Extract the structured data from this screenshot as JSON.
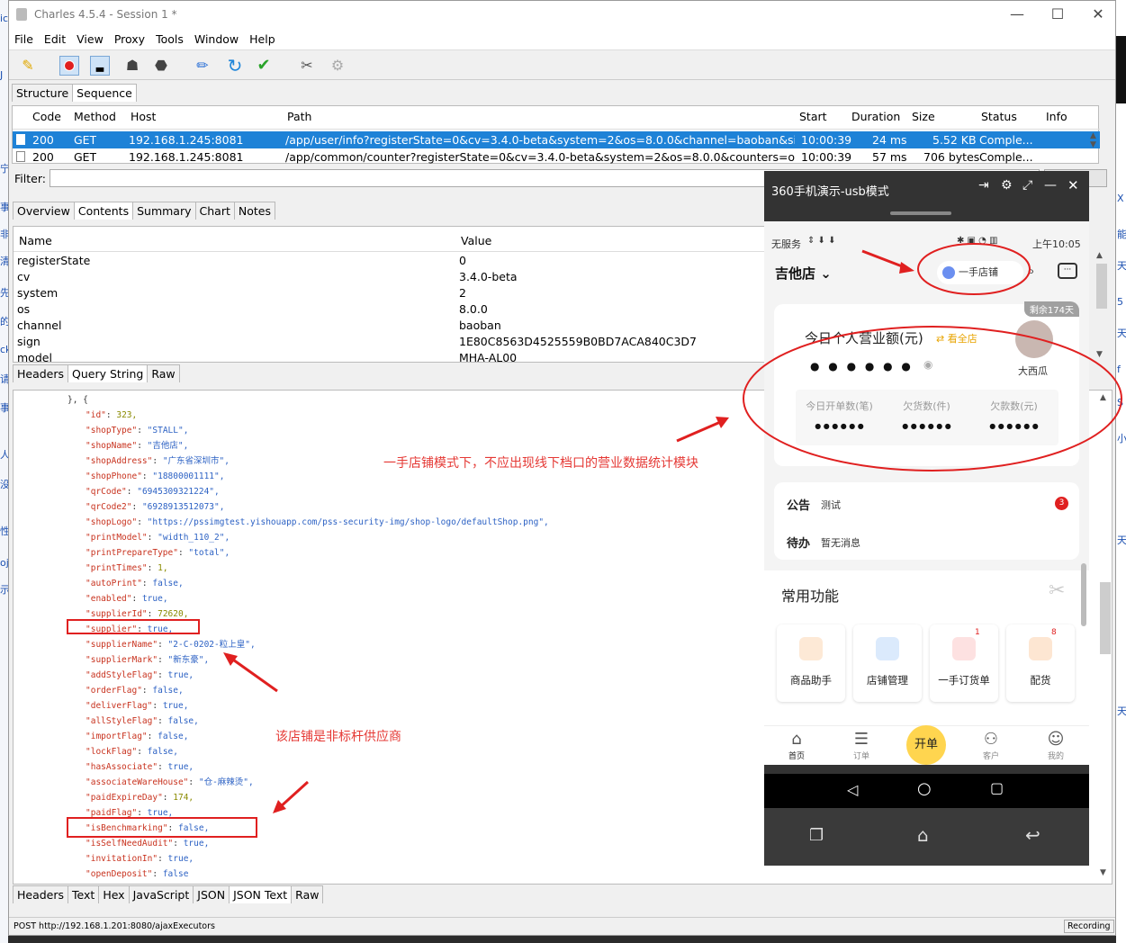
{
  "window": {
    "title": "Charles 4.5.4 - Session 1 *"
  },
  "menu": [
    "File",
    "Edit",
    "View",
    "Proxy",
    "Tools",
    "Window",
    "Help"
  ],
  "toolbar_icons": [
    "broom-icon",
    "record-icon",
    "throttle-icon",
    "turtle-icon",
    "stop-icon",
    "pen-icon",
    "refresh-icon",
    "check-icon",
    "tools-icon",
    "gear-icon"
  ],
  "view_tabs": [
    "Structure",
    "Sequence"
  ],
  "sequence": {
    "columns": [
      "Code",
      "Method",
      "Host",
      "Path",
      "Start",
      "Duration",
      "Size",
      "Status",
      "Info"
    ],
    "rows": [
      {
        "code": "200",
        "method": "GET",
        "host": "192.168.1.245:8081",
        "path": "/app/user/info?registerState=0&cv=3.4.0-beta&system=2&os=8.0.0&channel=baoban&sign=...",
        "start": "10:00:39",
        "duration": "24 ms",
        "size": "5.52 KB",
        "status": "Comple..."
      },
      {
        "code": "200",
        "method": "GET",
        "host": "192.168.1.245:8081",
        "path": "/app/common/counter?registerState=0&cv=3.4.0-beta&system=2&os=8.0.0&counters=order...",
        "start": "10:00:39",
        "duration": "57 ms",
        "size": "706 bytes",
        "status": "Comple..."
      }
    ]
  },
  "filter": {
    "label": "Filter:",
    "value": ""
  },
  "request_tabs": [
    "Overview",
    "Contents",
    "Summary",
    "Chart",
    "Notes"
  ],
  "params": {
    "columns": [
      "Name",
      "Value"
    ],
    "rows": [
      {
        "name": "registerState",
        "value": "0"
      },
      {
        "name": "cv",
        "value": "3.4.0-beta"
      },
      {
        "name": "system",
        "value": "2"
      },
      {
        "name": "os",
        "value": "8.0.0"
      },
      {
        "name": "channel",
        "value": "baoban"
      },
      {
        "name": "sign",
        "value": "1E80C8563D4525559B0BD7ACA840C3D7"
      },
      {
        "name": "model",
        "value": "MHA-AL00"
      }
    ]
  },
  "param_tabs": [
    "Headers",
    "Query String",
    "Raw"
  ],
  "json_lines": [
    {
      "k": "",
      "v": "}, {",
      "t": "p"
    },
    {
      "k": "\"id\"",
      "v": "323,",
      "t": "n"
    },
    {
      "k": "\"shopType\"",
      "v": "\"STALL\",",
      "t": "s"
    },
    {
      "k": "\"shopName\"",
      "v": "\"吉他店\",",
      "t": "s"
    },
    {
      "k": "\"shopAddress\"",
      "v": "\"广东省深圳市\",",
      "t": "s"
    },
    {
      "k": "\"shopPhone\"",
      "v": "\"18800001111\",",
      "t": "s"
    },
    {
      "k": "\"qrCode\"",
      "v": "\"6945309321224\",",
      "t": "s"
    },
    {
      "k": "\"qrCode2\"",
      "v": "\"6928913512073\",",
      "t": "s"
    },
    {
      "k": "\"shopLogo\"",
      "v": "\"https://pssimgtest.yishouapp.com/pss-security-img/shop-logo/defaultShop.png\",",
      "t": "s"
    },
    {
      "k": "\"printModel\"",
      "v": "\"width_110_2\",",
      "t": "s"
    },
    {
      "k": "\"printPrepareType\"",
      "v": "\"total\",",
      "t": "s"
    },
    {
      "k": "\"printTimes\"",
      "v": "1,",
      "t": "n"
    },
    {
      "k": "\"autoPrint\"",
      "v": "false,",
      "t": "b"
    },
    {
      "k": "\"enabled\"",
      "v": "true,",
      "t": "b"
    },
    {
      "k": "\"supplierId\"",
      "v": "72620,",
      "t": "n"
    },
    {
      "k": "\"supplier\"",
      "v": "true,",
      "t": "b"
    },
    {
      "k": "\"supplierName\"",
      "v": "\"2-C-0202-粒上皇\",",
      "t": "s"
    },
    {
      "k": "\"supplierMark\"",
      "v": "\"新东豪\",",
      "t": "s"
    },
    {
      "k": "\"addStyleFlag\"",
      "v": "true,",
      "t": "b"
    },
    {
      "k": "\"orderFlag\"",
      "v": "false,",
      "t": "b"
    },
    {
      "k": "\"deliverFlag\"",
      "v": "true,",
      "t": "b"
    },
    {
      "k": "\"allStyleFlag\"",
      "v": "false,",
      "t": "b"
    },
    {
      "k": "\"importFlag\"",
      "v": "false,",
      "t": "b"
    },
    {
      "k": "\"lockFlag\"",
      "v": "false,",
      "t": "b"
    },
    {
      "k": "\"hasAssociate\"",
      "v": "true,",
      "t": "b"
    },
    {
      "k": "\"associateWareHouse\"",
      "v": "\"仓-麻辣烫\",",
      "t": "s"
    },
    {
      "k": "\"paidExpireDay\"",
      "v": "174,",
      "t": "n"
    },
    {
      "k": "\"paidFlag\"",
      "v": "true,",
      "t": "b"
    },
    {
      "k": "\"isBenchmarking\"",
      "v": "false,",
      "t": "b"
    },
    {
      "k": "\"isSelfNeedAudit\"",
      "v": "true,",
      "t": "b"
    },
    {
      "k": "\"invitationIn\"",
      "v": "true,",
      "t": "b"
    },
    {
      "k": "\"openDeposit\"",
      "v": "false",
      "t": "b"
    }
  ],
  "body_tabs": [
    "Headers",
    "Text",
    "Hex",
    "JavaScript",
    "JSON",
    "JSON Text",
    "Raw"
  ],
  "status": {
    "left": "POST http://192.168.1.201:8080/ajaxExecutors",
    "right": "Recording"
  },
  "annotations": {
    "phone_note": "一手店铺模式下，不应出现线下档口的营业数据统计模块",
    "json_note": "该店铺是非标杆供应商"
  },
  "phone": {
    "title": "360手机演示-usb模式",
    "status_left": "无服务",
    "time": "上午10:05",
    "store": "吉他店",
    "mode_pill": "一手店铺",
    "remain_badge": "剩余174天",
    "revenue_title": "今日个人营业额(元)",
    "view_all": "看全店",
    "revenue_masked": "● ● ● ● ● ●",
    "avatar_name": "大西瓜",
    "stats": [
      {
        "label": "今日开单数(笔)",
        "value": "● ● ● ● ● ●"
      },
      {
        "label": "欠货数(件)",
        "value": "● ● ● ● ● ●"
      },
      {
        "label": "欠款数(元)",
        "value": "● ● ● ● ● ●"
      }
    ],
    "notice_label": "公告",
    "notice_text": "测试",
    "notice_badge": "3",
    "todo_label": "待办",
    "todo_text": "暂无消息",
    "common_title": "常用功能",
    "functions": [
      {
        "label": "商品助手",
        "badge": ""
      },
      {
        "label": "店铺管理",
        "badge": ""
      },
      {
        "label": "一手订货单",
        "badge": "1"
      },
      {
        "label": "配货",
        "badge": "8"
      }
    ],
    "nav": [
      {
        "label": "首页",
        "icon": "home-icon"
      },
      {
        "label": "订单",
        "icon": "list-icon"
      },
      {
        "label": "开单",
        "icon": "open-order-button"
      },
      {
        "label": "客户",
        "icon": "users-icon"
      },
      {
        "label": "我的",
        "icon": "face-icon"
      }
    ]
  },
  "colors": {
    "selection": "#1e82d7",
    "annotation": "#e53935",
    "accent": "#ffd54f"
  }
}
